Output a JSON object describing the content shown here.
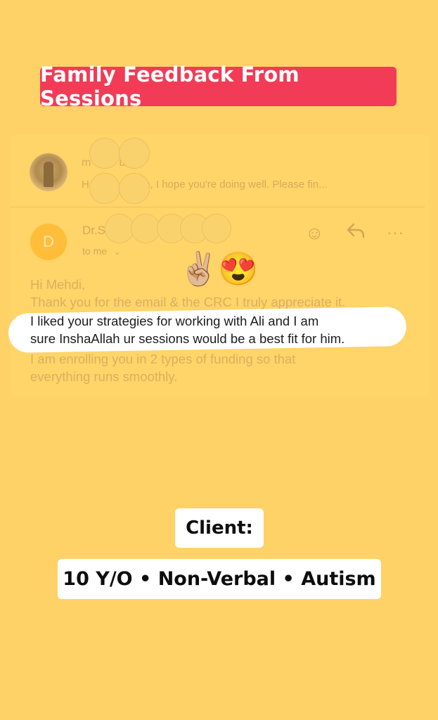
{
  "banner": {
    "title": "Family Feedback From Sessions",
    "color": "#f23b56"
  },
  "thread_1": {
    "name_fragment": "m",
    "name_tail": "u.",
    "preview_prefix": "H",
    "preview_suffix": "ah, I hope you're doing well. Please fin..."
  },
  "message": {
    "avatar_letter": "D",
    "sender_fragment": "Dr.Su",
    "recipient": "to me",
    "actions": [
      "emoji-react",
      "reply",
      "more"
    ]
  },
  "emojis": {
    "peace": "✌🏼",
    "heart_eyes": "😍"
  },
  "body": {
    "greeting": "Hi Mehdi,",
    "line_1": "Thank you for the email & the CRC I truly appreciate it.",
    "line_2": "I liked your strategies for working with Ali and I am",
    "line_3": "sure InshaAllah ur sessions would be  a best fit for him.",
    "line_4": "I am enrolling you in 2 types of funding so that",
    "line_5": "everything runs smoothly."
  },
  "client": {
    "label": "Client:",
    "info": "10 Y/O • Non-Verbal • Autism"
  },
  "colors": {
    "background": "#ffd268",
    "highlight": "#ffffff"
  }
}
